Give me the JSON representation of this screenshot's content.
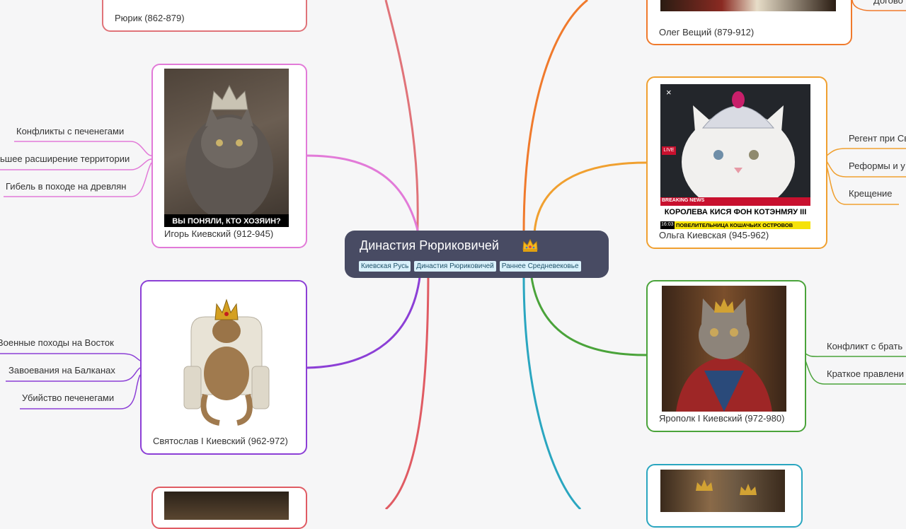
{
  "root": {
    "title": "Династия Рюриковичей",
    "icon": "crown-icon",
    "tags": [
      "Киевская Русь",
      "Династия Рюриковичей",
      "Раннее Средневековье"
    ]
  },
  "nodes": {
    "rurik": {
      "caption": "Рюрик (862-879)",
      "color": "#e07379"
    },
    "igor": {
      "caption": "Игорь Киевский (912-945)",
      "color": "#e27ad8",
      "image_caption": "ВЫ ПОНЯЛИ, КТО ХОЗЯИН?",
      "children": [
        "Конфликты с печенегами",
        "ьшее расширение территории",
        "Гибель в походе на древлян"
      ]
    },
    "svyatoslav": {
      "caption": "Святослав I Киевский (962-972)",
      "color": "#8c3fd6",
      "children": [
        "Военные походы на Восток",
        "Завоевания на Балканах",
        "Убийство печенегами"
      ]
    },
    "oleg": {
      "caption": "Олег Вещий (879-912)",
      "color": "#f07a2c",
      "children": [
        "Догово"
      ]
    },
    "olga": {
      "caption": "Ольга Киевская (945-962)",
      "color": "#f0a030",
      "news": {
        "close": "×",
        "live": "LIVE",
        "breaking": "BREAKING NEWS",
        "headline": "КОРОЛЕВА КИСЯ ФОН КОТЭНМЯУ III",
        "time": "16:03",
        "ticker": "ПОВЕЛИТЕЛЬНИЦА КОШАЧЬИХ ОСТРОВОВ"
      },
      "children": [
        "Регент при Св",
        "Реформы и у",
        "Крещение"
      ]
    },
    "yaropolk": {
      "caption": "Ярополк I Киевский (972-980)",
      "color": "#4aa33a",
      "children": [
        "Конфликт с брать",
        "Краткое правлени"
      ]
    },
    "bottom_left": {
      "color": "#e05b63"
    },
    "bottom_right": {
      "color": "#2aa6c0"
    }
  }
}
